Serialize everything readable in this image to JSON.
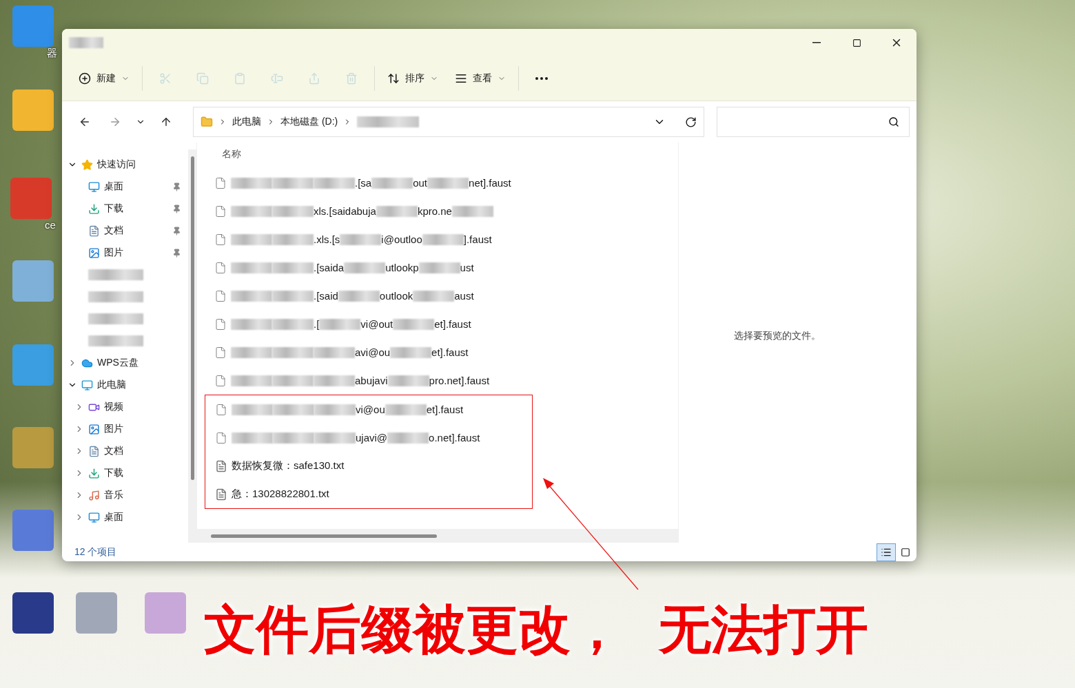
{
  "desktop_icons": [
    {
      "color": "#2f8ee8",
      "label": "器"
    },
    {
      "color": "#f2b530"
    },
    {
      "color": "#d83a2a",
      "label": "ce"
    },
    {
      "color": "#7fb0d8"
    },
    {
      "color": "#3a9ee0"
    },
    {
      "color": "#b89a40"
    },
    {
      "color": "#5a7ad8"
    },
    {
      "color": "#2a3a8a"
    },
    {
      "color": "#a0a8b8"
    },
    {
      "color": "#c8a8d8"
    }
  ],
  "window": {
    "toolbar": [
      {
        "kind": "new",
        "label": "新建",
        "disabled": false
      },
      {
        "kind": "cut",
        "disabled": true
      },
      {
        "kind": "copy",
        "disabled": true
      },
      {
        "kind": "paste",
        "disabled": true
      },
      {
        "kind": "rename",
        "disabled": true
      },
      {
        "kind": "share",
        "disabled": true
      },
      {
        "kind": "delete",
        "disabled": true
      },
      {
        "kind": "sort",
        "label": "排序",
        "disabled": false
      },
      {
        "kind": "view",
        "label": "查看",
        "disabled": false
      },
      {
        "kind": "more",
        "disabled": false
      }
    ],
    "breadcrumb": [
      {
        "kind": "text",
        "text": "此电脑"
      },
      {
        "kind": "text",
        "text": "本地磁盘 (D:)"
      },
      {
        "kind": "blur"
      }
    ],
    "sidebar": [
      {
        "kind": "star",
        "label": "快速访问",
        "expanded": true,
        "children": [
          {
            "kind": "desktop",
            "label": "桌面",
            "pinned": true
          },
          {
            "kind": "download",
            "label": "下载",
            "pinned": true
          },
          {
            "kind": "document",
            "label": "文档",
            "pinned": true
          },
          {
            "kind": "picture",
            "label": "图片",
            "pinned": true
          },
          {
            "kind": "blur"
          },
          {
            "kind": "blur"
          },
          {
            "kind": "blur"
          },
          {
            "kind": "blur"
          }
        ]
      },
      {
        "kind": "cloud",
        "label": "WPS云盘",
        "expanded": false
      },
      {
        "kind": "computer",
        "label": "此电脑",
        "expanded": true,
        "children": [
          {
            "kind": "video",
            "label": "视频",
            "expanded": false
          },
          {
            "kind": "picture",
            "label": "图片",
            "expanded": false
          },
          {
            "kind": "document",
            "label": "文档",
            "expanded": false
          },
          {
            "kind": "download",
            "label": "下载",
            "expanded": false
          },
          {
            "kind": "music",
            "label": "音乐",
            "expanded": false
          },
          {
            "kind": "desktop",
            "label": "桌面",
            "expanded": false
          }
        ]
      }
    ],
    "column_header": "名称",
    "files": [
      {
        "kind": "file",
        "highlighted": false,
        "segments": [
          {
            "kind": "blur"
          },
          {
            "kind": "blur"
          },
          {
            "kind": "blur"
          },
          {
            "kind": "text",
            "text": ".[sa"
          },
          {
            "kind": "blur"
          },
          {
            "kind": "text",
            "text": "out"
          },
          {
            "kind": "blur"
          },
          {
            "kind": "text",
            "text": "net].faust"
          }
        ]
      },
      {
        "kind": "file",
        "highlighted": false,
        "segments": [
          {
            "kind": "blur"
          },
          {
            "kind": "blur"
          },
          {
            "kind": "text",
            "text": "xls.[saidabuja"
          },
          {
            "kind": "blur"
          },
          {
            "kind": "text",
            "text": "kpro.ne"
          },
          {
            "kind": "blur"
          }
        ]
      },
      {
        "kind": "file",
        "highlighted": false,
        "segments": [
          {
            "kind": "blur"
          },
          {
            "kind": "blur"
          },
          {
            "kind": "text",
            "text": ".xls.[s"
          },
          {
            "kind": "blur"
          },
          {
            "kind": "text",
            "text": "i@outloo"
          },
          {
            "kind": "blur"
          },
          {
            "kind": "text",
            "text": "].faust"
          }
        ]
      },
      {
        "kind": "file",
        "highlighted": false,
        "segments": [
          {
            "kind": "blur"
          },
          {
            "kind": "blur"
          },
          {
            "kind": "text",
            "text": ".[saida"
          },
          {
            "kind": "blur"
          },
          {
            "kind": "text",
            "text": "utlookp"
          },
          {
            "kind": "blur"
          },
          {
            "kind": "text",
            "text": "ust"
          }
        ]
      },
      {
        "kind": "file",
        "highlighted": false,
        "segments": [
          {
            "kind": "blur"
          },
          {
            "kind": "blur"
          },
          {
            "kind": "text",
            "text": ".[said"
          },
          {
            "kind": "blur"
          },
          {
            "kind": "text",
            "text": "outlook"
          },
          {
            "kind": "blur"
          },
          {
            "kind": "text",
            "text": "aust"
          }
        ]
      },
      {
        "kind": "file",
        "highlighted": false,
        "segments": [
          {
            "kind": "blur"
          },
          {
            "kind": "blur"
          },
          {
            "kind": "text",
            "text": ".["
          },
          {
            "kind": "blur"
          },
          {
            "kind": "text",
            "text": "vi@out"
          },
          {
            "kind": "blur"
          },
          {
            "kind": "text",
            "text": "et].faust"
          }
        ]
      },
      {
        "kind": "file",
        "highlighted": false,
        "segments": [
          {
            "kind": "blur"
          },
          {
            "kind": "blur"
          },
          {
            "kind": "blur"
          },
          {
            "kind": "text",
            "text": "avi@ou"
          },
          {
            "kind": "blur"
          },
          {
            "kind": "text",
            "text": "et].faust"
          }
        ]
      },
      {
        "kind": "file",
        "highlighted": false,
        "segments": [
          {
            "kind": "blur"
          },
          {
            "kind": "blur"
          },
          {
            "kind": "blur"
          },
          {
            "kind": "text",
            "text": "abujavi"
          },
          {
            "kind": "blur"
          },
          {
            "kind": "text",
            "text": "pro.net].faust"
          }
        ]
      },
      {
        "kind": "file",
        "highlighted": true,
        "segments": [
          {
            "kind": "blur"
          },
          {
            "kind": "blur"
          },
          {
            "kind": "blur"
          },
          {
            "kind": "text",
            "text": "vi@ou"
          },
          {
            "kind": "blur"
          },
          {
            "kind": "text",
            "text": "et].faust"
          }
        ]
      },
      {
        "kind": "file",
        "highlighted": true,
        "segments": [
          {
            "kind": "blur"
          },
          {
            "kind": "blur"
          },
          {
            "kind": "blur"
          },
          {
            "kind": "text",
            "text": "ujavi@"
          },
          {
            "kind": "blur"
          },
          {
            "kind": "text",
            "text": "o.net].faust"
          }
        ]
      },
      {
        "kind": "text_file",
        "highlighted": true,
        "segments": [
          {
            "kind": "text",
            "text": "数据恢复微：safe130.txt"
          }
        ]
      },
      {
        "kind": "text_file",
        "highlighted": true,
        "segments": [
          {
            "kind": "text",
            "text": "急：13028822801.txt"
          }
        ]
      }
    ],
    "preview_message": "选择要预览的文件。",
    "status": "12 个项目",
    "view_modes": [
      {
        "kind": "details",
        "selected": true
      },
      {
        "kind": "tiles",
        "selected": false
      }
    ]
  },
  "caption": [
    "文件后缀被更改，",
    "无法打开"
  ]
}
